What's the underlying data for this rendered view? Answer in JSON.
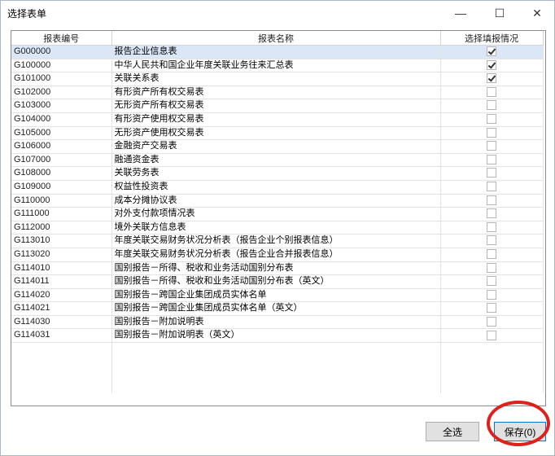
{
  "window": {
    "title": "选择表单",
    "minimize_glyph": "—",
    "maximize_glyph": "☐",
    "close_glyph": "✕"
  },
  "columns": {
    "code": "报表编号",
    "name": "报表名称",
    "status": "选择填报情况"
  },
  "rows": [
    {
      "code": "G000000",
      "name": "报告企业信息表",
      "checked": true
    },
    {
      "code": "G100000",
      "name": "中华人民共和国企业年度关联业务往来汇总表",
      "checked": true
    },
    {
      "code": "G101000",
      "name": "关联关系表",
      "checked": true
    },
    {
      "code": "G102000",
      "name": "有形资产所有权交易表",
      "checked": false
    },
    {
      "code": "G103000",
      "name": "无形资产所有权交易表",
      "checked": false
    },
    {
      "code": "G104000",
      "name": "有形资产使用权交易表",
      "checked": false
    },
    {
      "code": "G105000",
      "name": "无形资产使用权交易表",
      "checked": false
    },
    {
      "code": "G106000",
      "name": "金融资产交易表",
      "checked": false
    },
    {
      "code": "G107000",
      "name": "融通资金表",
      "checked": false
    },
    {
      "code": "G108000",
      "name": "关联劳务表",
      "checked": false
    },
    {
      "code": "G109000",
      "name": "权益性投资表",
      "checked": false
    },
    {
      "code": "G110000",
      "name": "成本分摊协议表",
      "checked": false
    },
    {
      "code": "G111000",
      "name": "对外支付款项情况表",
      "checked": false
    },
    {
      "code": "G112000",
      "name": "境外关联方信息表",
      "checked": false
    },
    {
      "code": "G113010",
      "name": "年度关联交易财务状况分析表（报告企业个别报表信息）",
      "checked": false
    },
    {
      "code": "G113020",
      "name": "年度关联交易财务状况分析表（报告企业合并报表信息）",
      "checked": false
    },
    {
      "code": "G114010",
      "name": "国别报告－所得、税收和业务活动国别分布表",
      "checked": false
    },
    {
      "code": "G114011",
      "name": "国别报告－所得、税收和业务活动国别分布表（英文）",
      "checked": false
    },
    {
      "code": "G114020",
      "name": "国别报告－跨国企业集团成员实体名单",
      "checked": false
    },
    {
      "code": "G114021",
      "name": "国别报告－跨国企业集团成员实体名单（英文）",
      "checked": false
    },
    {
      "code": "G114030",
      "name": "国别报告－附加说明表",
      "checked": false
    },
    {
      "code": "G114031",
      "name": "国别报告－附加说明表（英文）",
      "checked": false
    }
  ],
  "buttons": {
    "select_all": "全选",
    "save": "保存(0)"
  }
}
